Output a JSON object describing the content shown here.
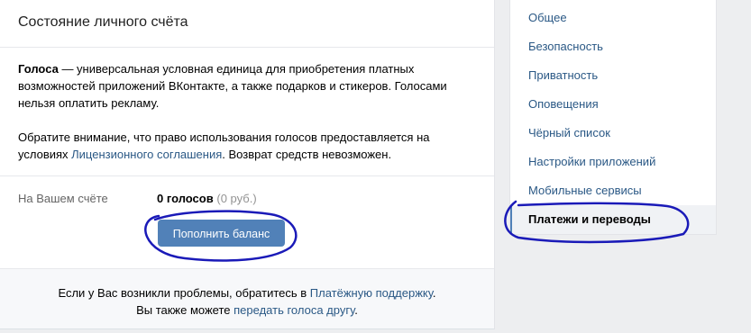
{
  "header": {
    "title": "Состояние личного счёта"
  },
  "info": {
    "votes_term": "Голоса",
    "description": " — универсальная условная единица для приобретения платных возможностей приложений ВКонтакте, а также подарков и стикеров. Голосами нельзя оплатить рекламу.",
    "notice_prefix": "Обратите внимание, что право использования голосов предоставляется на условиях ",
    "license_link": "Лицензионного соглашения",
    "notice_suffix": ". Возврат средств невозможен."
  },
  "balance": {
    "label": "На Вашем счёте",
    "votes": "0 голосов",
    "rubles": "(0 руб.)",
    "topup_button": "Пополнить баланс"
  },
  "footer": {
    "line1_prefix": "Если у Вас возникли проблемы, обратитесь в ",
    "support_link": "Платёжную поддержку",
    "line1_suffix": ".",
    "line2_prefix": "Вы также можете ",
    "transfer_link": "передать голоса другу",
    "line2_suffix": "."
  },
  "menu": {
    "items": [
      {
        "label": "Общее"
      },
      {
        "label": "Безопасность"
      },
      {
        "label": "Приватность"
      },
      {
        "label": "Оповещения"
      },
      {
        "label": "Чёрный список"
      },
      {
        "label": "Настройки приложений"
      },
      {
        "label": "Мобильные сервисы"
      },
      {
        "label": "Платежи и переводы"
      }
    ],
    "active_index": 7
  },
  "colors": {
    "accent": "#5181b8",
    "link": "#2a5885",
    "annotation": "#1a1ab8"
  }
}
